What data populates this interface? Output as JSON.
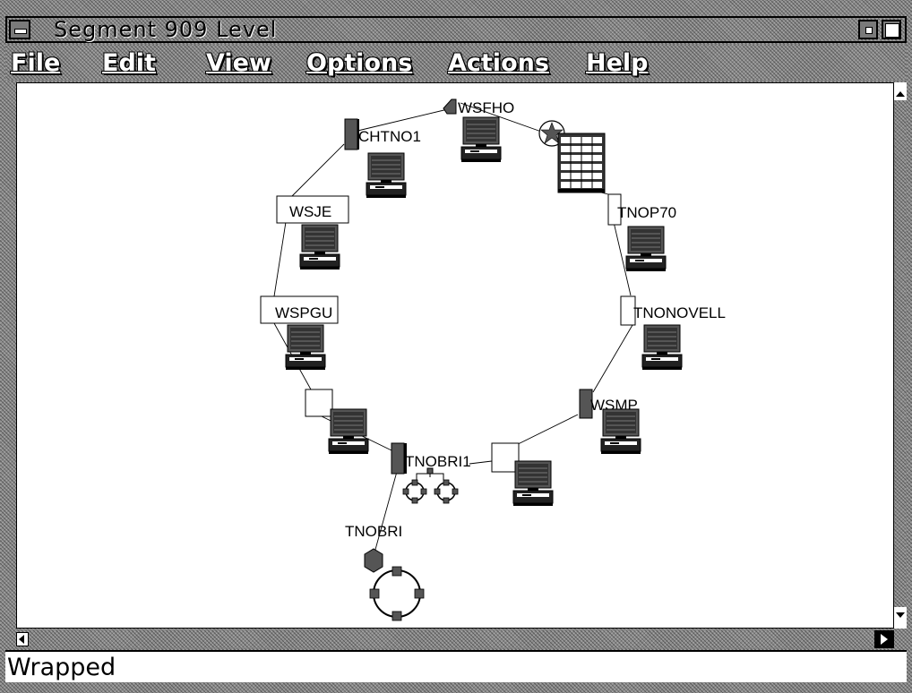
{
  "window": {
    "title": "Segment 909 Level"
  },
  "menu": {
    "items": [
      "File",
      "Edit",
      "View",
      "Options",
      "Actions",
      "Help"
    ]
  },
  "nodes": [
    {
      "label": "WSFHO",
      "kind": "workstation"
    },
    {
      "label": "CHTNO1",
      "kind": "workstation"
    },
    {
      "label": "",
      "kind": "server"
    },
    {
      "label": "WSJE",
      "kind": "workstation"
    },
    {
      "label": "TNOP70",
      "kind": "workstation"
    },
    {
      "label": "WSPGU",
      "kind": "workstation"
    },
    {
      "label": "TNONOVELL",
      "kind": "workstation"
    },
    {
      "label": "",
      "kind": "workstation"
    },
    {
      "label": "WSMP",
      "kind": "workstation"
    },
    {
      "label": "TNOBRI1",
      "kind": "bridge"
    },
    {
      "label": "",
      "kind": "workstation"
    },
    {
      "label": "TNOBRI",
      "kind": "ring-segment"
    }
  ],
  "status": {
    "text": "Wrapped"
  },
  "colors": {
    "frame": "#8a8a8a",
    "canvas": "#ffffff",
    "node_shadow": "#555555"
  }
}
